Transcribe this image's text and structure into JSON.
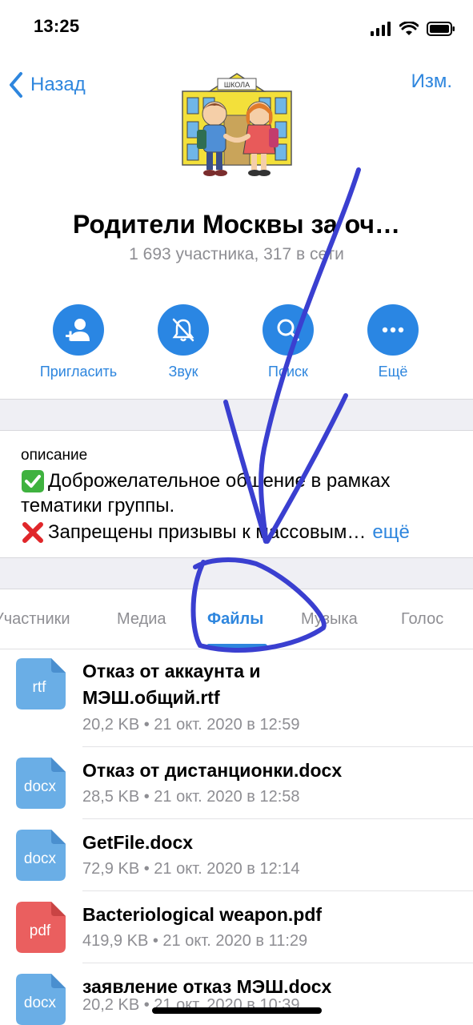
{
  "status_bar": {
    "time": "13:25"
  },
  "nav": {
    "back_label": "Назад",
    "edit_label": "Изм."
  },
  "group": {
    "title": "Родители Москвы за оч…",
    "subtitle": "1 693 участника, 317 в сети",
    "avatar_sign": "ШКОЛА"
  },
  "actions": [
    {
      "label": "Пригласить",
      "icon": "add-person-icon"
    },
    {
      "label": "Звук",
      "icon": "bell-muted-icon"
    },
    {
      "label": "Поиск",
      "icon": "search-icon"
    },
    {
      "label": "Ещё",
      "icon": "more-icon"
    }
  ],
  "description": {
    "label": "описание",
    "line1": "Доброжелательное общение в рамках",
    "line2": "тематики группы.",
    "line3": "Запрещены призывы к массовым…",
    "more": "ещё"
  },
  "tabs": [
    {
      "label": "Участники",
      "active": false
    },
    {
      "label": "Медиа",
      "active": false
    },
    {
      "label": "Файлы",
      "active": true
    },
    {
      "label": "Музыка",
      "active": false
    },
    {
      "label": "Голос",
      "active": false
    }
  ],
  "files": [
    {
      "ext": "rtf",
      "color": "#6aaee6",
      "name_line1": "Отказ от аккаунта и",
      "name_line2": "МЭШ.общий.rtf",
      "meta": "20,2 KB • 21 окт. 2020 в 12:59"
    },
    {
      "ext": "docx",
      "color": "#6aaee6",
      "name_line1": "Отказ от дистанционки.docx",
      "meta": "28,5 KB • 21 окт. 2020 в 12:58"
    },
    {
      "ext": "docx",
      "color": "#6aaee6",
      "name_line1": "GetFile.docx",
      "meta": "72,9 KB • 21 окт. 2020 в 12:14"
    },
    {
      "ext": "pdf",
      "color": "#ea5f5f",
      "name_line1": "Bacteriological weapon.pdf",
      "meta": "419,9 KB • 21 окт. 2020 в 11:29"
    },
    {
      "ext": "docx",
      "color": "#6aaee6",
      "name_line1": "заявление отказ МЭШ.docx",
      "meta": "20,2 KB • 21 окт. 2020 в 10:39"
    }
  ],
  "colors": {
    "accent": "#2e86de",
    "pdf": "#ea5f5f",
    "doc": "#6aaee6",
    "annotation": "#3a3fd0"
  }
}
